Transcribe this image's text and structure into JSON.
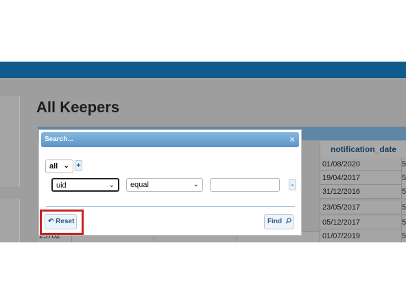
{
  "page": {
    "title": "All Keepers"
  },
  "grid": {
    "visible_column_header": "notification_date",
    "rows": [
      {
        "notification_date": "01/08/2020",
        "next_col": "5"
      },
      {
        "notification_date": "19/04/2017",
        "next_col": "5"
      },
      {
        "notification_date": "31/12/2016",
        "next_col": "5"
      },
      {
        "notification_date": "23/05/2017",
        "next_col": "5"
      },
      {
        "notification_date": "05/12/2017",
        "next_col": "5"
      },
      {
        "notification_date": "01/07/2019",
        "next_col": "5"
      }
    ],
    "partial_row_id": "25702"
  },
  "dialog": {
    "title": "Search...",
    "close_icon": "×",
    "group_op": "all",
    "add_rule_label": "+",
    "rule": {
      "field": "uid",
      "operator": "equal",
      "value": "",
      "remove_label": "-"
    },
    "reset_label": "Reset",
    "find_label": "Find"
  },
  "colors": {
    "topbar": "#0f5b8d",
    "dialog_title": "#6ea3d2",
    "highlight": "#c8201e"
  }
}
